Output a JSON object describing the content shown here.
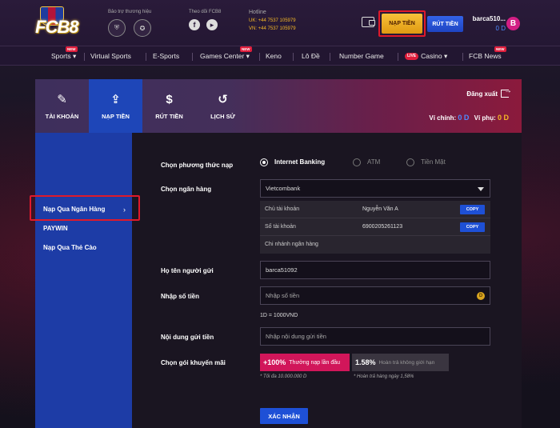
{
  "header": {
    "logo_text": "FCB8",
    "sponsor_label": "Bảo trợ thương hiệu",
    "follow_label": "Theo dõi FCB8",
    "hotline_title": "Hotline",
    "hotline_uk": "UK: +44 7537 105979",
    "hotline_vn": "VN: +44 7537 105979",
    "deposit_label": "NẠP TIỀN",
    "withdraw_label": "RÚT TIỀN",
    "username": "barca510...",
    "balance": "0 D",
    "avatar_letter": "B"
  },
  "nav": {
    "items": [
      "Sports",
      "Virtual Sports",
      "E-Sports",
      "Games Center",
      "Keno",
      "Lô Đề",
      "Number Game",
      "Casino",
      "FCB News"
    ],
    "new_tag": "NEW",
    "live_tag": "LIVE"
  },
  "tabs": {
    "items": [
      "TÀI KHOẢN",
      "NẠP TIỀN",
      "RÚT TIỀN",
      "LỊCH SỬ"
    ],
    "logout": "Đăng xuất",
    "main_wallet_label": "Ví chính:",
    "main_wallet_value": "0 D",
    "sub_wallet_label": "Ví phụ:",
    "sub_wallet_value": "0 D"
  },
  "sidebar": {
    "items": [
      "Nạp Qua Ngân Hàng",
      "PAYWIN",
      "Nạp Qua Thẻ Cào"
    ]
  },
  "form": {
    "method_label": "Chọn phương thức nạp",
    "methods": [
      "Internet Banking",
      "ATM",
      "Tiền Mặt"
    ],
    "bank_label": "Chọn ngân hàng",
    "bank_value": "Vietcombank",
    "account_owner_key": "Chủ tài khoản",
    "account_owner_value": "Nguyễn Văn A",
    "account_number_key": "Số tài khoản",
    "account_number_value": "6900205261123",
    "branch_key": "Chi nhánh ngân hàng",
    "copy_label": "COPY",
    "sender_label": "Họ tên người gửi",
    "sender_value": "barca51092",
    "amount_label": "Nhập số tiền",
    "amount_placeholder": "Nhập số tiền",
    "coin_symbol": "D",
    "rate_note": "1D = 1000VND",
    "content_label": "Nội dung gửi tiền",
    "content_placeholder": "Nhập nội dung gửi tiền",
    "promo_label": "Chọn gói khuyến mãi",
    "promo1_pct": "+100%",
    "promo1_text": "Thưởng nạp lần đầu",
    "promo1_note": "* Tối đa 10.000.000 D",
    "promo2_pct": "1.58%",
    "promo2_text": "Hoàn trả không giới hạn",
    "promo2_note": "* Hoàn trả hàng ngày 1,58%",
    "submit_label": "XÁC NHẬN"
  },
  "colors": {
    "accent_blue": "#1e46b8",
    "deposit_gold": "#f7c23a",
    "highlight_red": "#e0192b",
    "promo_pink": "#d1165a"
  }
}
